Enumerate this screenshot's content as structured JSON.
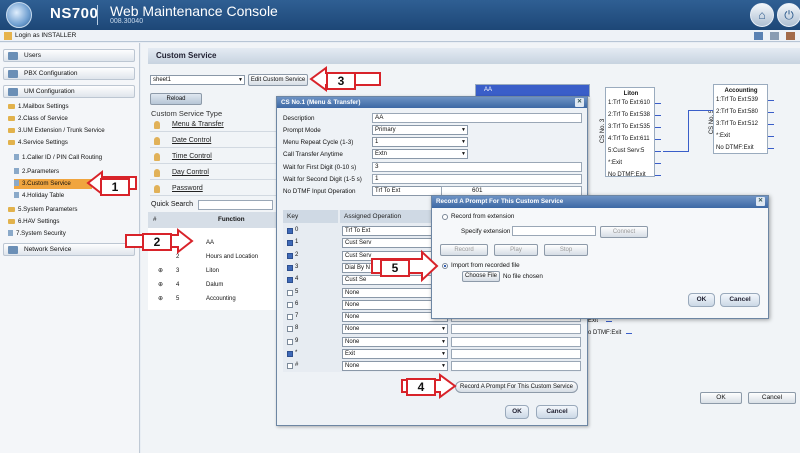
{
  "header": {
    "product": "NS700",
    "title": "Web Maintenance Console",
    "version": "008.30040",
    "login": "Login as INSTALLER"
  },
  "sidebar": {
    "sections": [
      "Users",
      "PBX Configuration",
      "UM Configuration",
      "Network Service"
    ],
    "items": [
      "1.Mailbox Settings",
      "2.Class of Service",
      "3.UM Extension / Trunk Service",
      "4.Service Settings",
      "1.Caller ID / PIN Call Routing",
      "2.Parameters",
      "3.Custom Service",
      "4.Holiday Table",
      "5.System Parameters",
      "6.HAV Settings",
      "7.System Security"
    ]
  },
  "main": {
    "title": "Custom Service",
    "sheet_value": "sheet1",
    "edit_button": "Edit Custom Service",
    "reload_button": "Reload",
    "type_header": "Custom Service Type",
    "types": [
      "Menu & Transfer",
      "Date Control",
      "Time Control",
      "Day Control",
      "Password"
    ],
    "quick_search": "Quick Search",
    "col_no": "#",
    "col_function": "Function",
    "rows": [
      {
        "num": "1",
        "fn": "AA"
      },
      {
        "num": "2",
        "fn": "Hours and Location"
      },
      {
        "num": "3",
        "fn": "Liton"
      },
      {
        "num": "4",
        "fn": "Dalum"
      },
      {
        "num": "5",
        "fn": "Accounting"
      }
    ],
    "ok_button": "OK",
    "cancel_button": "Cancel"
  },
  "tree": {
    "aa_header": "AA",
    "liton_title": "Liton",
    "liton_items": [
      "1:Trf To Ext:610",
      "2:Trf To Ext:538",
      "3:Trf To Ext:535",
      "4:Trf To Ext:611",
      "5:Cust Serv:5",
      "*:Exit",
      "No DTMF:Exit"
    ],
    "liton_vert": "CS No. 3",
    "acc_title": "Accounting",
    "acc_items": [
      "1:Trf To Ext:539",
      "2:Trf To Ext:580",
      "3:Trf To Ext:512",
      "*:Exit",
      "No DTMF:Exit"
    ],
    "acc_vert": "CS No. 5",
    "partial1": "Exit",
    "partial2": "o DTMF:Exit"
  },
  "dialog1": {
    "title": "CS No.1 (Menu & Transfer)",
    "fields": [
      {
        "label": "Description",
        "value": "AA"
      },
      {
        "label": "Prompt Mode",
        "value": "Primary"
      },
      {
        "label": "Menu Repeat Cycle (1-3)",
        "value": "1"
      },
      {
        "label": "Call Transfer Anytime",
        "value": "Extn"
      },
      {
        "label": "Wait for First Digit (0-10 s)",
        "value": "3"
      },
      {
        "label": "Wait for Second Digit (1-5 s)",
        "value": "1"
      },
      {
        "label": "No DTMF Input Operation",
        "value": "Trf To Ext",
        "extra": "601"
      }
    ],
    "col_key": "Key",
    "col_op": "Assigned Operation",
    "keys": [
      {
        "k": "0",
        "op": "Trf To Ext",
        "on": true
      },
      {
        "k": "1",
        "op": "Cust Serv",
        "on": true
      },
      {
        "k": "2",
        "op": "Cust Serv",
        "on": true
      },
      {
        "k": "3",
        "op": "Dial By N",
        "on": true
      },
      {
        "k": "4",
        "op": "Cust Se",
        "on": true
      },
      {
        "k": "5",
        "op": "None",
        "on": false
      },
      {
        "k": "6",
        "op": "None",
        "on": false
      },
      {
        "k": "7",
        "op": "None",
        "on": false
      },
      {
        "k": "8",
        "op": "None",
        "on": false
      },
      {
        "k": "9",
        "op": "None",
        "on": false
      },
      {
        "k": "*",
        "op": "Exit",
        "on": true
      },
      {
        "k": "#",
        "op": "None",
        "on": false
      }
    ],
    "record_button": "Record A Prompt For This Custom Service",
    "ok": "OK",
    "cancel": "Cancel"
  },
  "dialog2": {
    "title": "Record A Prompt For This Custom Service",
    "opt1": "Record from extension",
    "specify": "Specify extension",
    "connect": "Connect",
    "record": "Record",
    "play": "Play",
    "stop": "Stop",
    "opt2": "Import from recorded file",
    "choose": "Choose File",
    "nofile": "No file chosen",
    "ok": "OK",
    "cancel": "Cancel"
  },
  "callouts": [
    "1",
    "2",
    "3",
    "4",
    "5"
  ],
  "colors": {
    "callout": "#d8232a",
    "header": "#1d4777",
    "selected": "#f0a53f"
  }
}
